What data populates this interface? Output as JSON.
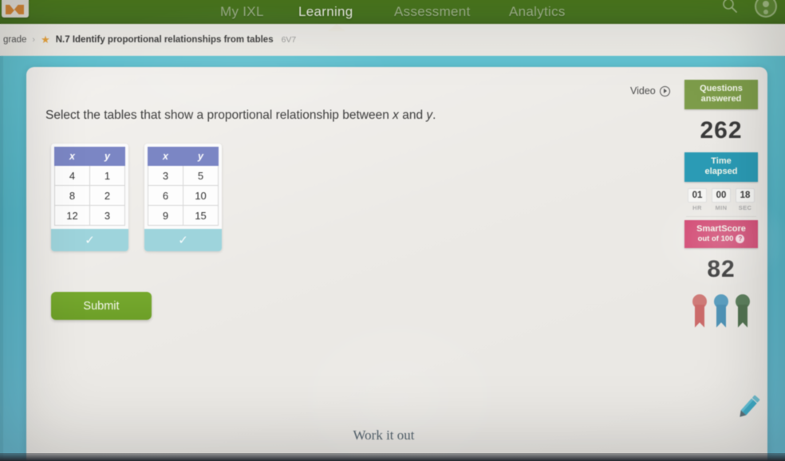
{
  "nav": {
    "logo_name": "ixl-logo",
    "items": [
      {
        "label": "My IXL",
        "active": false
      },
      {
        "label": "Learning",
        "active": true
      },
      {
        "label": "Assessment",
        "active": false
      },
      {
        "label": "Analytics",
        "active": false
      }
    ],
    "search_icon": "search-icon",
    "avatar_icon": "user-avatar-icon"
  },
  "breadcrumb": {
    "grade": "grade",
    "separator": "›",
    "star_icon": "star-icon",
    "skill": "N.7 Identify proportional relationships from tables",
    "code": "6V7"
  },
  "main": {
    "question_prefix": "Select the tables that show a proportional relationship between ",
    "var_x": "x",
    "question_mid": " and ",
    "var_y": "y",
    "question_suffix": ".",
    "tables": [
      {
        "headers": [
          "x",
          "y"
        ],
        "rows": [
          [
            "4",
            "1"
          ],
          [
            "8",
            "2"
          ],
          [
            "12",
            "3"
          ]
        ],
        "footer_icon": "checkmark-icon",
        "footer_glyph": "✓"
      },
      {
        "headers": [
          "x",
          "y"
        ],
        "rows": [
          [
            "3",
            "5"
          ],
          [
            "6",
            "10"
          ],
          [
            "9",
            "15"
          ]
        ],
        "footer_icon": "checkmark-icon",
        "footer_glyph": "✓"
      }
    ],
    "submit_label": "Submit",
    "work_it_out": "Work it out",
    "pencil_icon": "pencil-icon"
  },
  "video": {
    "label": "Video",
    "play_icon": "play-circle-icon"
  },
  "stats": {
    "questions_answered_label_line1": "Questions",
    "questions_answered_label_line2": "answered",
    "questions_answered_value": "262",
    "time_elapsed_label_line1": "Time",
    "time_elapsed_label_line2": "elapsed",
    "time": [
      {
        "value": "01",
        "unit": "HR"
      },
      {
        "value": "00",
        "unit": "MIN"
      },
      {
        "value": "18",
        "unit": "SEC"
      }
    ],
    "smartscore_label": "SmartScore",
    "smartscore_sub": "out of 100",
    "smartscore_help_glyph": "?",
    "smartscore_value": "82",
    "awards": [
      {
        "name": "award-ribbon-bronze",
        "color": "#cf7b78"
      },
      {
        "name": "award-ribbon-silver",
        "color": "#5c9fc0"
      },
      {
        "name": "award-ribbon-gold",
        "color": "#5d7f5d"
      }
    ]
  },
  "colors": {
    "nav_green": "#4b7a22",
    "page_teal": "#5cc0d0",
    "card": "#efedea",
    "table_header_blue": "#7b86c4",
    "table_footer_teal": "#9ed4dc",
    "submit_green": "#6d9f28",
    "banner_questions": "#7d9c4a",
    "banner_time": "#2b9bb5",
    "banner_smartscore": "#d0436e",
    "pencil_teal": "#49acc4"
  }
}
